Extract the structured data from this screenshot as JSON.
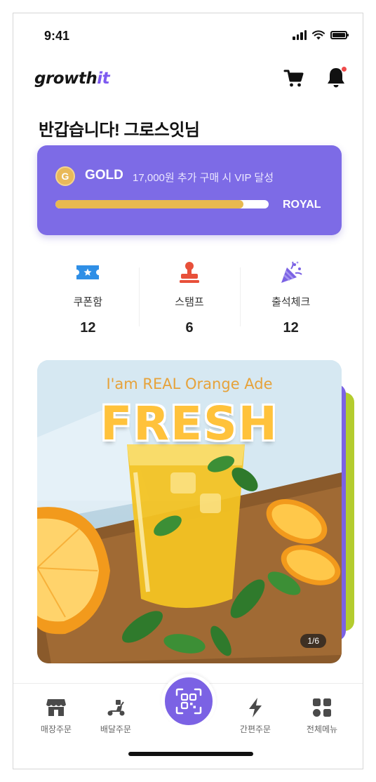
{
  "status_bar": {
    "time": "9:41"
  },
  "header": {
    "logo_main": "growth",
    "logo_accent": "it",
    "icons": [
      "cart-icon",
      "bell-icon"
    ]
  },
  "greeting": "반갑습니다! 그로스잇님",
  "membership": {
    "badge_letter": "G",
    "grade": "GOLD",
    "note": "17,000원 추가 구매 시 VIP 달성",
    "next_grade": "ROYAL",
    "progress_fraction": 0.88,
    "colors": {
      "card": "#7d6be6",
      "progress": "#e8b94f",
      "badge": "#e9b95a"
    }
  },
  "stats": [
    {
      "label": "쿠폰함",
      "value": "12",
      "icon": "ticket-icon",
      "color": "#2f8fe6"
    },
    {
      "label": "스탬프",
      "value": "6",
      "icon": "stamp-icon",
      "color": "#e8503a"
    },
    {
      "label": "출석체크",
      "value": "12",
      "icon": "party-popper-icon",
      "color": "#7b62e4"
    }
  ],
  "banner": {
    "tagline": "I'am REAL Orange Ade",
    "headline": "FRESH",
    "counter": "1/6"
  },
  "tabs": [
    {
      "label": "매장주문",
      "icon": "store-icon"
    },
    {
      "label": "배달주문",
      "icon": "scooter-icon"
    },
    {
      "label": "간편주문",
      "icon": "lightning-icon"
    },
    {
      "label": "전체메뉴",
      "icon": "grid-menu-icon"
    }
  ],
  "qr_button": {
    "icon": "qr-code-icon",
    "color": "#7b62e4"
  }
}
